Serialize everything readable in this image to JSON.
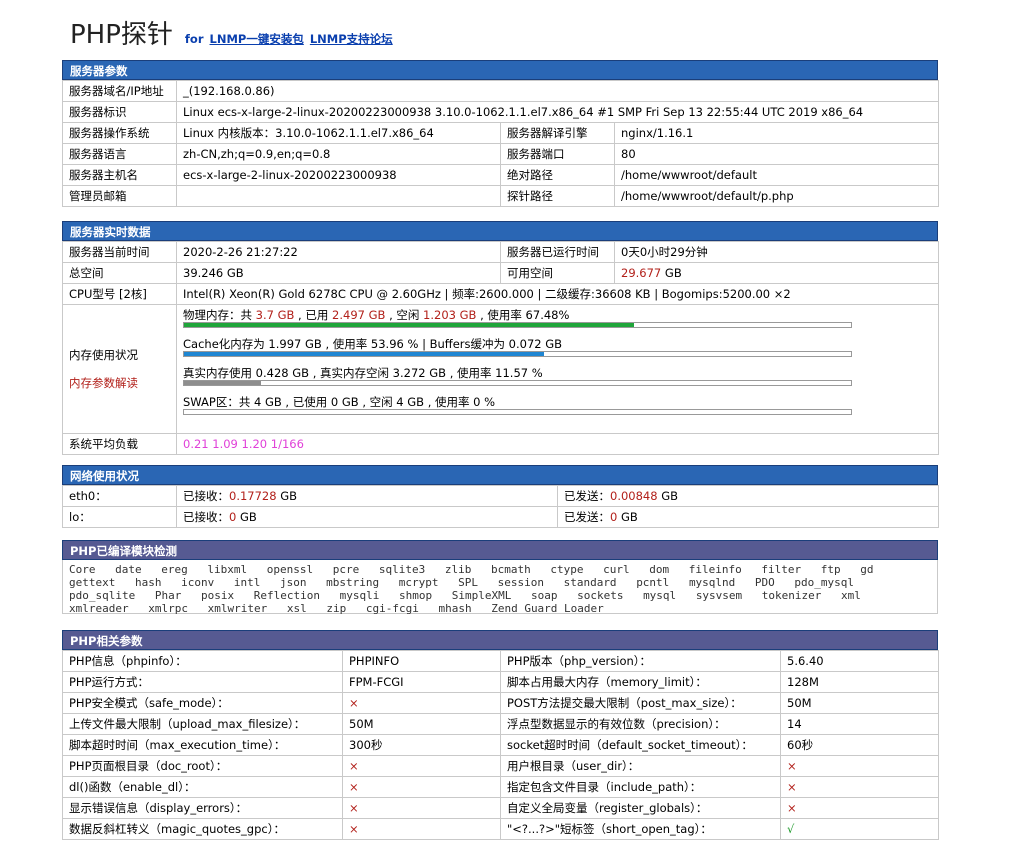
{
  "header": {
    "title": "PHP探针",
    "for": "for",
    "link1": "LNMP一键安装包",
    "link2": "LNMP支持论坛"
  },
  "server_params": {
    "title": "服务器参数",
    "rows": [
      {
        "l": "服务器域名/IP地址",
        "v": "_(192.168.0.86)"
      },
      {
        "l": "服务器标识",
        "v": "Linux ecs-x-large-2-linux-20200223000938 3.10.0-1062.1.1.el7.x86_64 #1 SMP Fri Sep 13 22:55:44 UTC 2019 x86_64"
      },
      {
        "l": "服务器操作系统",
        "v": "Linux  内核版本：3.10.0-1062.1.1.el7.x86_64",
        "l2": "服务器解译引擎",
        "v2": "nginx/1.16.1"
      },
      {
        "l": "服务器语言",
        "v": "zh-CN,zh;q=0.9,en;q=0.8",
        "l2": "服务器端口",
        "v2": "80"
      },
      {
        "l": "服务器主机名",
        "v": "ecs-x-large-2-linux-20200223000938",
        "l2": "绝对路径",
        "v2": "/home/wwwroot/default"
      },
      {
        "l": "管理员邮箱",
        "v": "",
        "l2": "探针路径",
        "v2": "/home/wwwroot/default/p.php"
      }
    ]
  },
  "realtime": {
    "title": "服务器实时数据",
    "time_l": "服务器当前时间",
    "time_v": "2020-2-26 21:27:22",
    "uptime_l": "服务器已运行时间",
    "uptime_v": "0天0小时29分钟",
    "disk_l": "总空间",
    "disk_v": "39.246 GB",
    "free_l": "可用空间",
    "free_v": "29.677",
    "free_u": " GB",
    "cpu_l": "CPU型号 [2核]",
    "cpu_v": "Intel(R) Xeon(R) Gold 6278C CPU @ 2.60GHz | 频率:2600.000 | 二级缓存:36608 KB | Bogomips:5200.00 ×2",
    "mem_l": "内存使用状况",
    "mem_link": "内存参数解读",
    "phys": {
      "a": "物理内存：共 ",
      "total": "3.7 GB",
      "b": " , 已用 ",
      "used": "2.497 GB",
      "c": " , 空闲 ",
      "free": "1.203 GB",
      "d": " , 使用率 67.48%",
      "ratio": 0.6748,
      "color": "#1fa53a"
    },
    "cache": {
      "text": "Cache化内存为 1.997 GB , 使用率 53.96 % | Buffers缓冲为 0.072 GB",
      "ratio": 0.5396,
      "color": "#1f86d2"
    },
    "real": {
      "text": "真实内存使用 0.428 GB , 真实内存空闲 3.272 GB , 使用率 11.57 %",
      "ratio": 0.1157,
      "color": "#8e8e8e"
    },
    "swap": {
      "text": "SWAP区：共 4 GB , 已使用 0 GB , 空闲 4 GB , 使用率 0 %",
      "ratio": 0,
      "color": "#8e8e8e"
    },
    "load_l": "系统平均负载",
    "load_v": "0.21 1.09 1.20 1/166"
  },
  "network": {
    "title": "网络使用状况",
    "rows": [
      {
        "iface": "eth0：",
        "rx_l": "已接收：",
        "rx": "0.17728",
        "rx_u": " GB",
        "tx_l": "已发送：",
        "tx": "0.00848",
        "tx_u": " GB"
      },
      {
        "iface": "lo：",
        "rx_l": "已接收：",
        "rx": "0",
        "rx_u": " GB",
        "tx_l": "已发送：",
        "tx": "0",
        "tx_u": " GB"
      }
    ]
  },
  "modules": {
    "title": "PHP已编译模块检测",
    "list": [
      "Core",
      "date",
      "ereg",
      "libxml",
      "openssl",
      "pcre",
      "sqlite3",
      "zlib",
      "bcmath",
      "ctype",
      "curl",
      "dom",
      "fileinfo",
      "filter",
      "ftp",
      "gd",
      "gettext",
      "hash",
      "iconv",
      "intl",
      "json",
      "mbstring",
      "mcrypt",
      "SPL",
      "session",
      "standard",
      "pcntl",
      "mysqlnd",
      "PDO",
      "pdo_mysql",
      "pdo_sqlite",
      "Phar",
      "posix",
      "Reflection",
      "mysqli",
      "shmop",
      "SimpleXML",
      "soap",
      "sockets",
      "mysql",
      "sysvsem",
      "tokenizer",
      "xml",
      "xmlreader",
      "xmlrpc",
      "xmlwriter",
      "xsl",
      "zip",
      "cgi-fcgi",
      "mhash",
      "Zend Guard Loader"
    ]
  },
  "php_params": {
    "title": "PHP相关参数",
    "rows": [
      {
        "l": "PHP信息（phpinfo）：",
        "v": "PHPINFO",
        "l2": "PHP版本（php_version）：",
        "v2": "5.6.40"
      },
      {
        "l": "PHP运行方式：",
        "v": "FPM-FCGI",
        "l2": "脚本占用最大内存（memory_limit）：",
        "v2": "128M"
      },
      {
        "l": "PHP安全模式（safe_mode）：",
        "v": "×",
        "vc": "red",
        "l2": "POST方法提交最大限制（post_max_size）：",
        "v2": "50M"
      },
      {
        "l": "上传文件最大限制（upload_max_filesize）：",
        "v": "50M",
        "l2": "浮点型数据显示的有效位数（precision）：",
        "v2": "14"
      },
      {
        "l": "脚本超时时间（max_execution_time）：",
        "v": "300秒",
        "l2": "socket超时时间（default_socket_timeout）：",
        "v2": "60秒"
      },
      {
        "l": "PHP页面根目录（doc_root）：",
        "v": "×",
        "vc": "red",
        "l2": "用户根目录（user_dir）：",
        "v2": "×",
        "v2c": "red"
      },
      {
        "l": "dl()函数（enable_dl）：",
        "v": "×",
        "vc": "red",
        "l2": "指定包含文件目录（include_path）：",
        "v2": "×",
        "v2c": "red"
      },
      {
        "l": "显示错误信息（display_errors）：",
        "v": "×",
        "vc": "red",
        "l2": "自定义全局变量（register_globals）：",
        "v2": "×",
        "v2c": "red"
      },
      {
        "l": "数据反斜杠转义（magic_quotes_gpc）：",
        "v": "×",
        "vc": "red",
        "l2": "\"<?...?>\"短标签（short_open_tag）：",
        "v2": "√",
        "v2c": "ok"
      }
    ]
  }
}
